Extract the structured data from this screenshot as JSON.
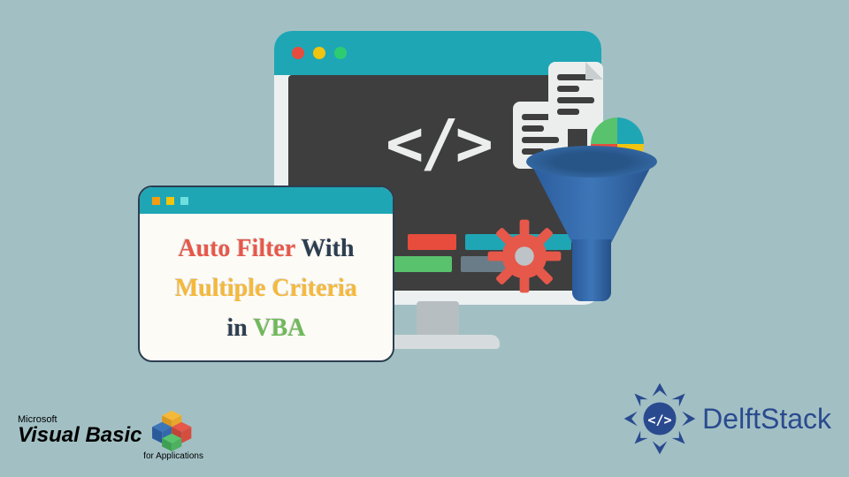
{
  "title_card": {
    "auto_filter": "Auto Filter",
    "with": "With",
    "multiple_criteria": "Multiple Criteria",
    "in": "in",
    "vba": "VBA"
  },
  "vb_logo": {
    "microsoft": "Microsoft",
    "visual_basic": "Visual Basic",
    "for_applications": "for Applications"
  },
  "delftstack": {
    "label": "DelftStack"
  },
  "colors": {
    "bg": "#a2c0c4",
    "teal": "#1fa6b5",
    "red": "#e74c3c",
    "yellow": "#f1c40f",
    "green": "#2ecc71",
    "dark": "#3e3e3e",
    "blue": "#2a4a8f"
  }
}
